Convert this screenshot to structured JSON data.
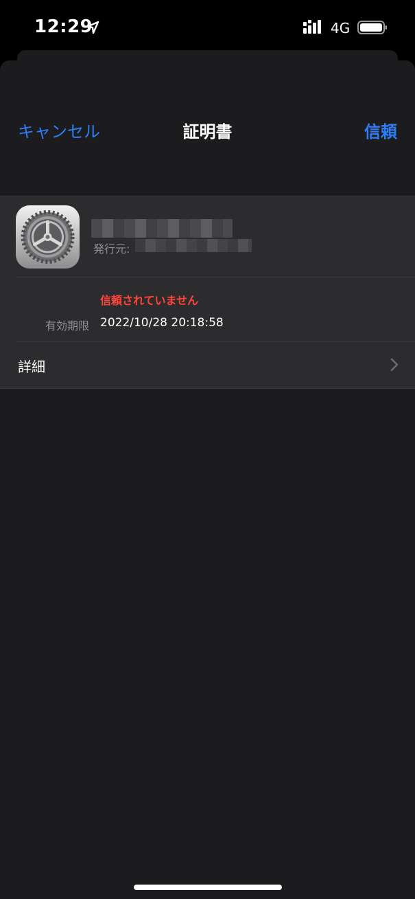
{
  "status_bar": {
    "time": "12:29",
    "network": "4G",
    "icons": [
      "location-arrow-icon",
      "signal-icon",
      "battery-icon"
    ]
  },
  "nav": {
    "cancel_label": "キャンセル",
    "title": "証明書",
    "trust_label": "信頼"
  },
  "certificate": {
    "icon": "settings-gear-icon",
    "issuer_label": "発行元:",
    "status": "信頼されていません",
    "expiry_label": "有効期限",
    "expiry_value": "2022/10/28 20:18:58"
  },
  "details": {
    "label": "詳細",
    "icon": "chevron-right-icon"
  },
  "colors": {
    "accent": "#2f7df6",
    "danger": "#ff453a",
    "sheet_bg": "#1c1c1e",
    "group_bg": "#2c2c2e"
  }
}
